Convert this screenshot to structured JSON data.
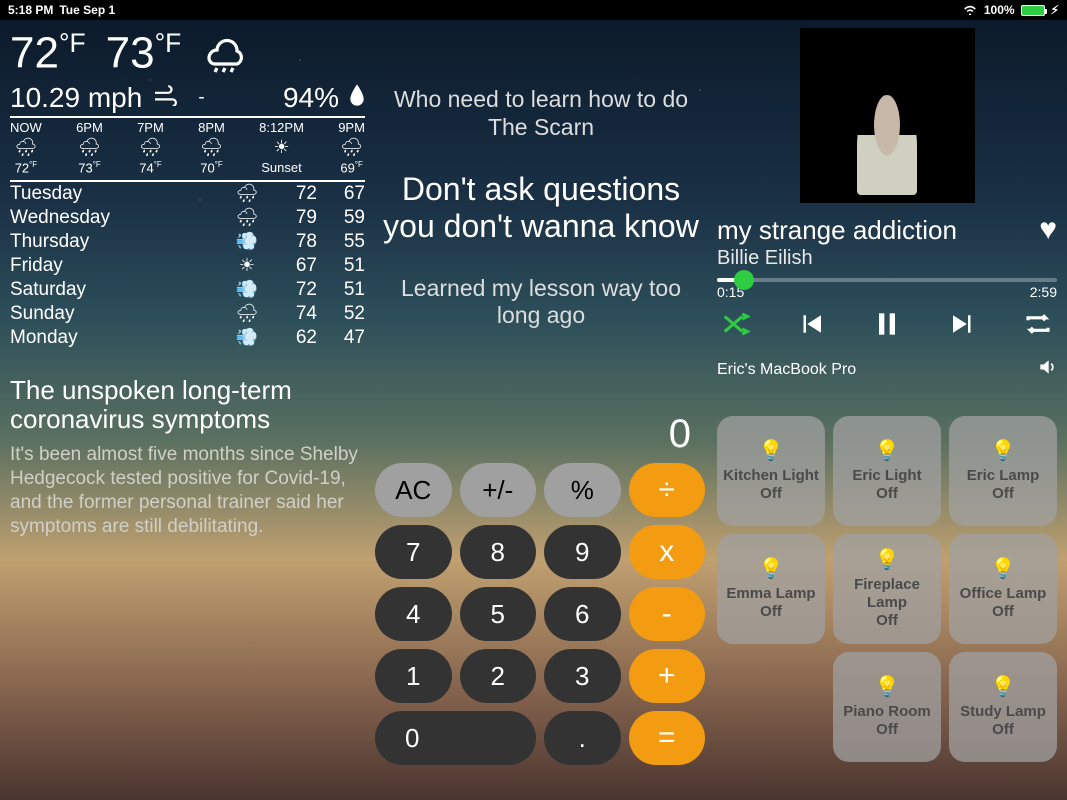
{
  "status": {
    "time": "5:18 PM",
    "date": "Tue Sep 1",
    "battery_pct": "100%"
  },
  "weather": {
    "temp_now": "72",
    "temp_feels": "73",
    "wind": "10.29 mph",
    "humidity": "94%",
    "hourly": [
      {
        "t": "NOW",
        "tp": "72",
        "sunset": false
      },
      {
        "t": "6PM",
        "tp": "73",
        "sunset": false
      },
      {
        "t": "7PM",
        "tp": "74",
        "sunset": false
      },
      {
        "t": "8PM",
        "tp": "70",
        "sunset": false
      },
      {
        "t": "8:12PM",
        "tp": "Sunset",
        "sunset": true
      },
      {
        "t": "9PM",
        "tp": "69",
        "sunset": false
      }
    ],
    "daily": [
      {
        "d": "Tuesday",
        "hi": "72",
        "lo": "67",
        "ic": "rain"
      },
      {
        "d": "Wednesday",
        "hi": "79",
        "lo": "59",
        "ic": "rain"
      },
      {
        "d": "Thursday",
        "hi": "78",
        "lo": "55",
        "ic": "wind"
      },
      {
        "d": "Friday",
        "hi": "67",
        "lo": "51",
        "ic": "sun"
      },
      {
        "d": "Saturday",
        "hi": "72",
        "lo": "51",
        "ic": "wind"
      },
      {
        "d": "Sunday",
        "hi": "74",
        "lo": "52",
        "ic": "rain"
      },
      {
        "d": "Monday",
        "hi": "62",
        "lo": "47",
        "ic": "wind"
      }
    ]
  },
  "news": {
    "title": "The unspoken long-term coronavirus symptoms",
    "body": "It's been almost five months since Shelby Hedgecock tested positive for Covid-19, and the former personal trainer said her symptoms are still debilitating."
  },
  "lyrics": {
    "prev": "Who need to learn how to do The Scarn",
    "current": "Don't ask questions you don't wanna know",
    "next": "Learned my lesson way too long ago"
  },
  "calc": {
    "display": "0",
    "ac": "AC",
    "pm": "+/-",
    "pct": "%",
    "div": "÷",
    "mul": "x",
    "sub": "-",
    "add": "+",
    "eq": "=",
    "d7": "7",
    "d8": "8",
    "d9": "9",
    "d4": "4",
    "d5": "5",
    "d6": "6",
    "d1": "1",
    "d2": "2",
    "d3": "3",
    "d0": "0",
    "dot": "."
  },
  "music": {
    "track": "my strange addiction",
    "artist": "Billie Eilish",
    "elapsed": "0:15",
    "duration": "2:59",
    "device": "Eric's MacBook Pro"
  },
  "home": {
    "tiles": [
      {
        "name": "Kitchen Light",
        "state": "Off"
      },
      {
        "name": "Eric Light",
        "state": "Off"
      },
      {
        "name": "Eric Lamp",
        "state": "Off"
      },
      {
        "name": "Emma Lamp",
        "state": "Off"
      },
      {
        "name": "Fireplace Lamp",
        "state": "Off"
      },
      {
        "name": "Office Lamp",
        "state": "Off"
      },
      {
        "name": "Piano Room",
        "state": "Off"
      },
      {
        "name": "Study Lamp",
        "state": "Off"
      }
    ]
  }
}
